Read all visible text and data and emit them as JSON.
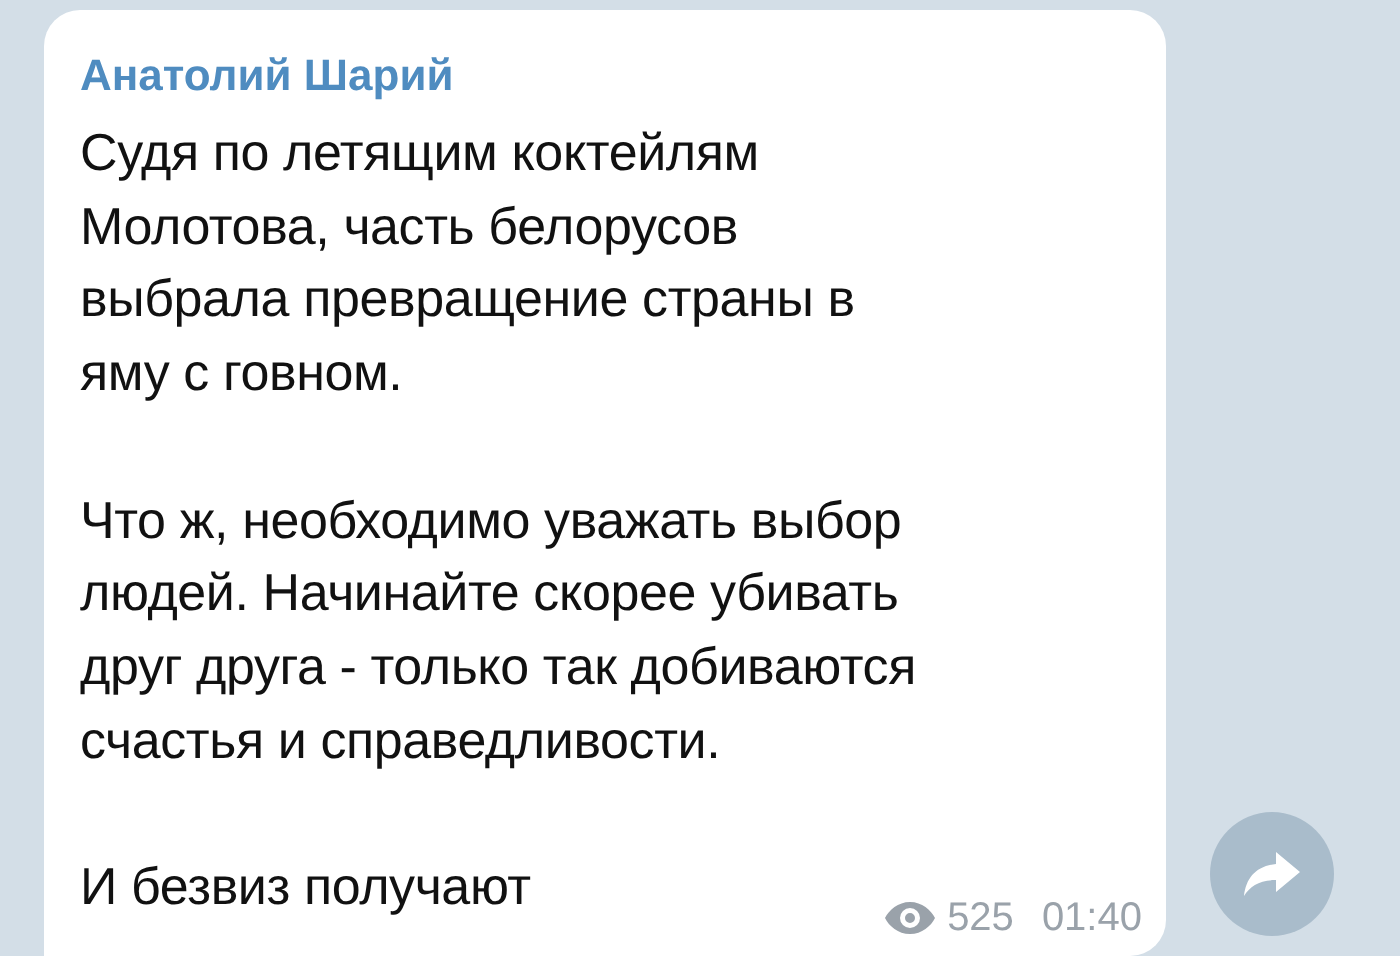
{
  "message": {
    "author": "Анатолий Шарий",
    "paragraphs": [
      "Судя по летящим коктейлям\nМолотова, часть белорусов\nвыбрала превращение страны в\nяму с говном.",
      "Что ж, необходимо уважать выбор\nлюдей. Начинайте скорее убивать\nдруг друга - только так добиваются\nсчастья и справедливости.",
      "И безвиз получают"
    ],
    "views": "525",
    "time": "01:40"
  }
}
